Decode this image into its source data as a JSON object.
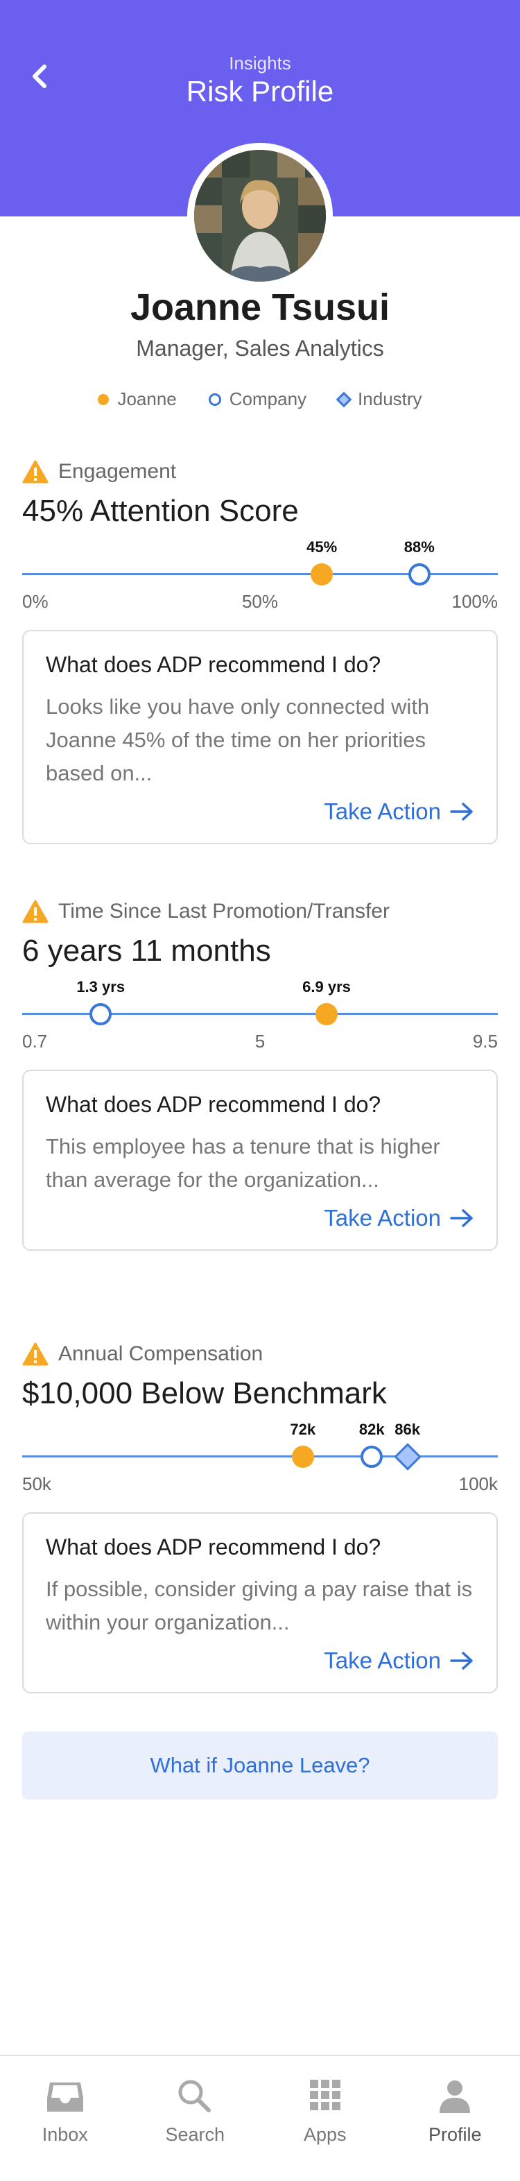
{
  "header": {
    "subtitle": "Insights",
    "title": "Risk Profile",
    "color": "#6b5ff0"
  },
  "profile": {
    "name": "Joanne Tsusui",
    "role": "Manager, Sales Analytics"
  },
  "legend": [
    "Joanne",
    "Company",
    "Industry"
  ],
  "sections": [
    {
      "label": "Engagement",
      "title": "45% Attention Score",
      "ticks": [
        "0%",
        "50%",
        "100%"
      ],
      "markers": [
        {
          "label": "45%",
          "value": 0.63,
          "style": "fill"
        },
        {
          "label": "88%",
          "value": 0.835,
          "style": "ring"
        }
      ],
      "card": {
        "question": "What does ADP recommend I do?",
        "text": "Looks like you have only connected with Joanne 45% of the time on her priorities based on...",
        "action": "Take Action"
      }
    },
    {
      "label": "Time Since Last Promotion/Transfer",
      "title": "6 years 11 months",
      "ticks": [
        "0.7",
        "5",
        "9.5"
      ],
      "markers": [
        {
          "label": "1.3 yrs",
          "value": 0.165,
          "style": "ring"
        },
        {
          "label": "6.9 yrs",
          "value": 0.64,
          "style": "fill"
        }
      ],
      "card": {
        "question": "What does ADP recommend I do?",
        "text": "This employee has a tenure that is higher than average for the organization...",
        "action": "Take Action"
      }
    },
    {
      "label": "Annual Compensation",
      "title": "$10,000 Below Benchmark",
      "ticks": [
        "50k",
        "",
        "100k"
      ],
      "markers": [
        {
          "label": "72k",
          "value": 0.59,
          "style": "fill"
        },
        {
          "label": "82k",
          "value": 0.735,
          "style": "ring"
        },
        {
          "label": "86k",
          "value": 0.81,
          "style": "dia"
        }
      ],
      "card": {
        "question": "What does ADP recommend I do?",
        "text": "If possible, consider giving a pay raise that is within your organization...",
        "action": "Take Action"
      }
    }
  ],
  "what_if": "What if Joanne Leave?",
  "tabs": [
    {
      "label": "Inbox",
      "icon": "inbox-icon"
    },
    {
      "label": "Search",
      "icon": "search-icon"
    },
    {
      "label": "Apps",
      "icon": "apps-grid-icon"
    },
    {
      "label": "Profile",
      "icon": "person-icon"
    }
  ],
  "colors": {
    "accent": "#2f6fd6",
    "warning": "#f7a823",
    "company": "#3a78d8"
  }
}
